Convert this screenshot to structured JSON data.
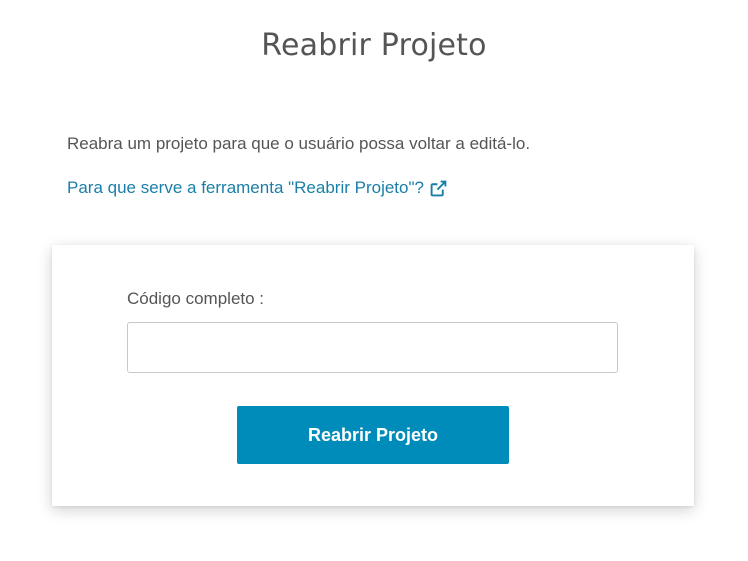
{
  "page": {
    "title": "Reabrir Projeto",
    "description": "Reabra um projeto para que o usuário possa voltar a editá-lo.",
    "help_link": {
      "label": "Para que serve a ferramenta \"Reabrir Projeto\"?",
      "icon": "external-link-icon"
    }
  },
  "form": {
    "code_label": "Código completo :",
    "code_value": "",
    "code_placeholder": "",
    "submit_label": "Reabrir Projeto"
  },
  "colors": {
    "accent": "#008cba",
    "link": "#1a7fa8",
    "text": "#555555"
  }
}
